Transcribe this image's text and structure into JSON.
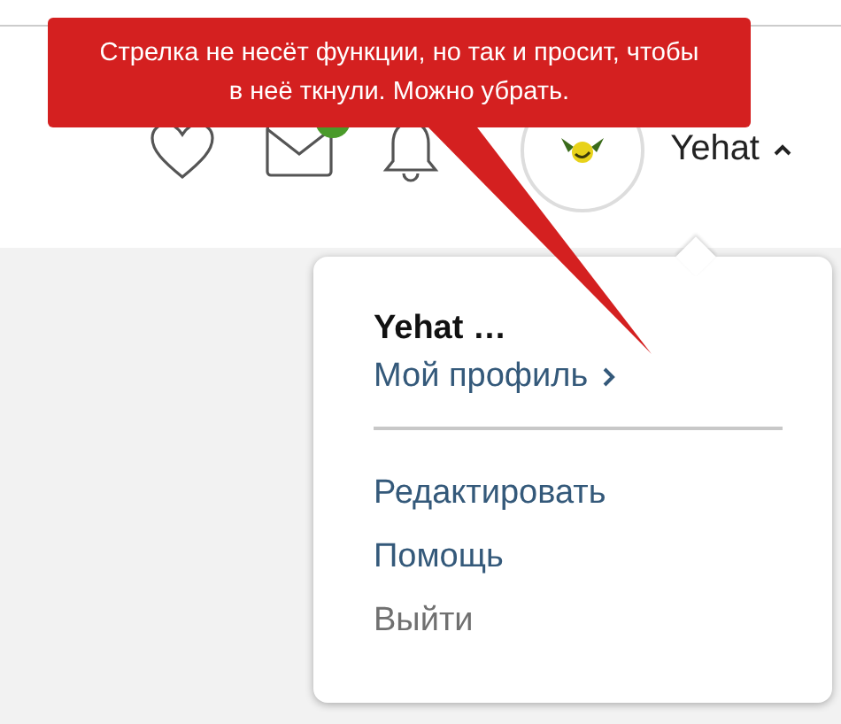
{
  "callout": {
    "text": "Стрелка не несёт функции, но так и просит, чтобы в неё ткнули. Можно убрать."
  },
  "header": {
    "username": "Yehat",
    "expanded": true,
    "messages_badge": true
  },
  "menu": {
    "title": "Yehat …",
    "profile_link": "Мой профиль",
    "items": [
      {
        "label": "Редактировать",
        "kind": "link"
      },
      {
        "label": "Помощь",
        "kind": "link"
      },
      {
        "label": "Выйти",
        "kind": "logout"
      }
    ]
  }
}
